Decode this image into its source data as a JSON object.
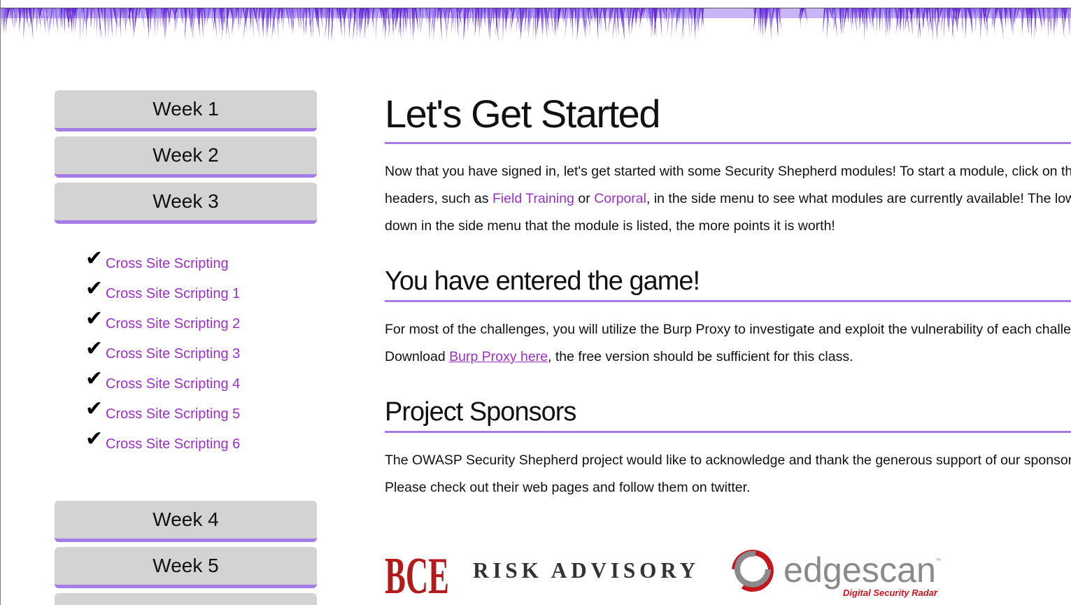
{
  "sidebar": {
    "weeks_top": [
      {
        "label": "Week 1"
      },
      {
        "label": "Week 2"
      },
      {
        "label": "Week 3"
      }
    ],
    "check_glyph": "✔",
    "modules": [
      {
        "label": "Cross Site Scripting"
      },
      {
        "label": "Cross Site Scripting 1"
      },
      {
        "label": "Cross Site Scripting 2"
      },
      {
        "label": "Cross Site Scripting 3"
      },
      {
        "label": "Cross Site Scripting 4"
      },
      {
        "label": "Cross Site Scripting 5"
      },
      {
        "label": "Cross Site Scripting 6"
      }
    ],
    "weeks_bottom": [
      {
        "label": "Week 4"
      },
      {
        "label": "Week 5"
      }
    ]
  },
  "main": {
    "title": "Let's Get Started",
    "intro": {
      "line1": "Now that you have signed in, let's get started with some Security Shepherd modules! To start a module, click on th",
      "line2_pre": "headers, such as ",
      "link_field_training": "Field Training",
      "line2_or": " or ",
      "link_corporal": "Corporal",
      "line2_post": ", in the side menu to see what modules are currently available! The low",
      "line3": "down in the side menu that the module is listed, the more points it is worth!"
    },
    "game": {
      "heading": "You have entered the game!",
      "line1": "For most of the challenges, you will utilize the Burp Proxy to investigate and exploit the vulnerability of each challe",
      "line2_pre": "Download ",
      "link_burp": "Burp Proxy here",
      "line2_post": ", the free version should be sufficient for this class."
    },
    "sponsors": {
      "heading": "Project Sponsors",
      "line1": "The OWASP Security Shepherd project would like to acknowledge and thank the generous support of our sponsor",
      "line2": "Please check out their web pages and follow them on twitter.",
      "logos": {
        "bce_text": "BCE",
        "risk_advisory_text": "RISK ADVISORY",
        "edgescan_text": "edgescan",
        "edgescan_tm": "™",
        "edgescan_tagline": "Digital Security Radar",
        "edgescan_tagline_tm": "™"
      }
    }
  },
  "colors": {
    "accent": "#a57be8",
    "link": "#9b30c8",
    "button_bg": "#d3d3d3",
    "banner": "#5a1fd6",
    "bce_red": "#b31b1b",
    "risk_red": "#c4161c",
    "edgescan_grey": "#8a8a8a"
  }
}
